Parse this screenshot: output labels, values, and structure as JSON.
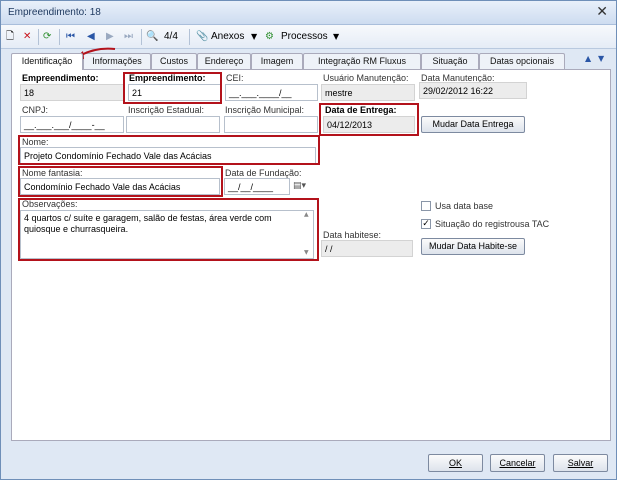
{
  "window": {
    "title": "Empreendimento: 18"
  },
  "toolbar": {
    "record_counter": "4/4",
    "anexos_label": "Anexos",
    "processos_label": "Processos"
  },
  "tabs": [
    "Identificação",
    "Informações",
    "Custos",
    "Endereço",
    "Imagem",
    "Integração RM Fluxus",
    "Situação",
    "Datas opcionais"
  ],
  "form": {
    "empreendimento_id_label": "Empreendimento:",
    "empreendimento_id_value": "18",
    "empreendimento_code_label": "Empreendimento:",
    "empreendimento_code_value": "21",
    "cei_label": "CEI:",
    "cei_value": "__.___.____/__",
    "usuario_label": "Usuário Manutenção:",
    "usuario_value": "mestre",
    "data_manutencao_label": "Data Manutenção:",
    "data_manutencao_value": "29/02/2012 16:22",
    "cnpj_label": "CNPJ:",
    "cnpj_value": "__.___.___/____-__",
    "inscricao_estadual_label": "Inscrição Estadual:",
    "inscricao_municipal_label": "Inscrição Municipal:",
    "data_entrega_label": "Data de Entrega:",
    "data_entrega_value": "04/12/2013",
    "mudar_data_entrega_label": "Mudar Data Entrega",
    "nome_label": "Nome:",
    "nome_value": "Projeto Condomínio Fechado Vale das Acácias",
    "nome_fantasia_label": "Nome fantasia:",
    "nome_fantasia_value": "Condomínio Fechado Vale das Acácias",
    "data_fundacao_label": "Data de Fundação:",
    "data_fundacao_value": "__/__/____",
    "observacoes_label": "Observações:",
    "observacoes_value": "4 quartos c/ suíte e garagem, salão de festas, área verde com quiosque e churrasqueira.",
    "usa_data_base_label": "Usa data base",
    "situacao_registro_label": "Situação do registro",
    "usa_tac_label": "usa TAC",
    "data_habitese_label": "Data habitese:",
    "data_habitese_value": "/ /",
    "mudar_habitese_label": "Mudar Data Habite-se"
  },
  "footer": {
    "ok_label": "OK",
    "cancel_label": "Cancelar",
    "save_label": "Salvar"
  },
  "colors": {
    "highlight": "#b3121b",
    "window_bg": "#dfe8f4"
  }
}
